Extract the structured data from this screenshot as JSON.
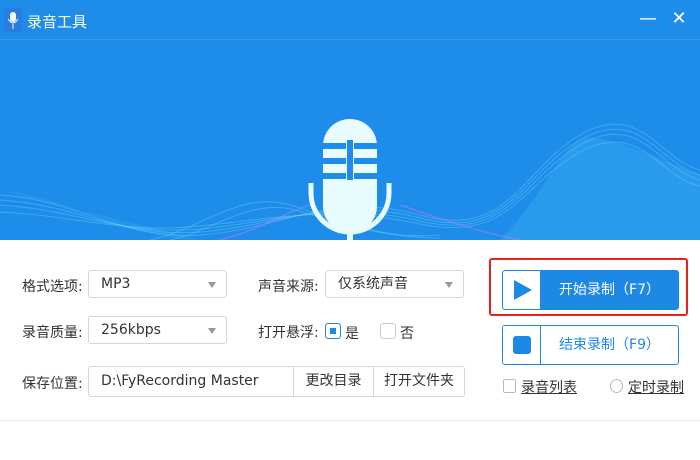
{
  "window": {
    "title": "录音工具",
    "minimize": "—",
    "close": "✕"
  },
  "form": {
    "format_label": "格式选项:",
    "format_value": "MP3",
    "source_label": "声音来源:",
    "source_value": "仅系统声音",
    "quality_label": "录音质量:",
    "quality_value": "256kbps",
    "float_label": "打开悬浮:",
    "float_yes": "是",
    "float_no": "否",
    "float_selected": "是",
    "save_label": "保存位置:",
    "save_path": "D:\\FyRecording Master",
    "change_dir": "更改目录",
    "open_folder": "打开文件夹"
  },
  "actions": {
    "start": "开始录制（F7）",
    "stop": "结束录制（F9）",
    "list": "录音列表",
    "timer": "定时录制"
  },
  "colors": {
    "brand": "#1e8ce9",
    "accent": "#1e88e5",
    "highlight": "#e52323"
  }
}
